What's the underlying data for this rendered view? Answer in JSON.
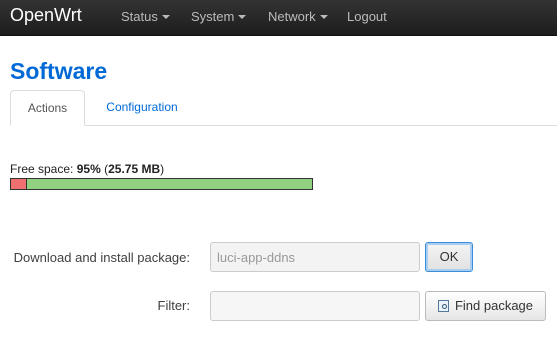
{
  "header": {
    "brand": "OpenWrt",
    "menu": [
      "Status",
      "System",
      "Network",
      "Logout"
    ]
  },
  "page": {
    "title": "Software",
    "tabs": [
      {
        "label": "Actions",
        "active": true
      },
      {
        "label": "Configuration",
        "active": false
      }
    ]
  },
  "storage": {
    "free_label": "Free space:",
    "free_percent": "95%",
    "free_size": "25.75 MB",
    "used_fraction": 0.05,
    "colors": {
      "used": "#f07070",
      "free": "#90d080"
    }
  },
  "install": {
    "label": "Download and install package:",
    "value": "luci-app-ddns",
    "button": "OK"
  },
  "filter": {
    "label": "Filter:",
    "value": "",
    "button": "Find package",
    "button_icon": "find-icon"
  },
  "colors": {
    "accent": "#0069d6",
    "navbar": "#222222"
  }
}
